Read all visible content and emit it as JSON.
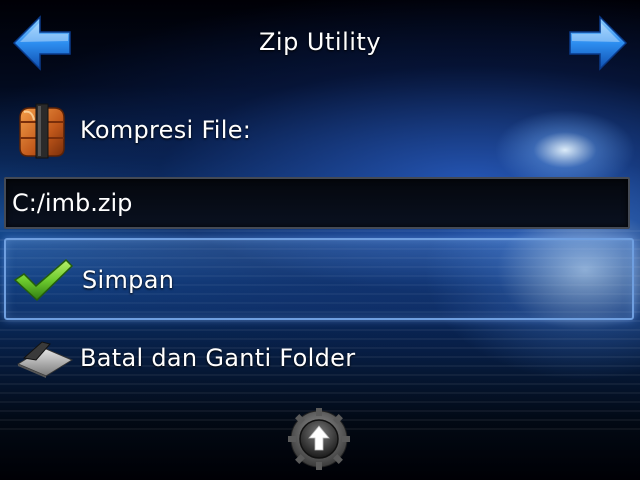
{
  "header": {
    "title": "Zip Utility",
    "back_icon": "arrow-left-icon",
    "next_icon": "arrow-right-icon"
  },
  "compress": {
    "label": "Kompresi File:",
    "icon": "archive-box-icon",
    "path_value": "C:/imb.zip"
  },
  "actions": {
    "save_label": "Simpan",
    "save_icon": "checkmark-icon",
    "cancel_label": "Batal dan Ganti Folder",
    "cancel_icon": "folder-icon"
  },
  "footer": {
    "up_icon": "up-arrow-gear-icon"
  },
  "colors": {
    "arrow_blue": "#2d8ef0",
    "check_green": "#6ecb2e",
    "selection_border": "#6f9fe0"
  }
}
